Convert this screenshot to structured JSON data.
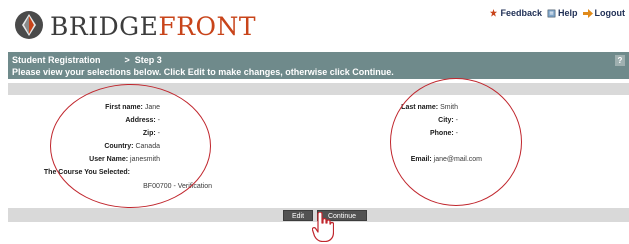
{
  "logo": {
    "name_part1": "BRIDGE",
    "name_part2": "FRONT"
  },
  "toplinks": [
    {
      "label": "Feedback",
      "icon": "feedback-icon"
    },
    {
      "label": "Help",
      "icon": "help-icon"
    },
    {
      "label": "Logout",
      "icon": "logout-arrow-icon"
    }
  ],
  "header": {
    "title": "Student Registration",
    "step_arrow": ">",
    "step": "Step 3",
    "instructions": "Please view your selections below. Click Edit to make changes, otherwise click Continue.",
    "help_icon": "?"
  },
  "left_fields": [
    {
      "label": "First name:",
      "value": "Jane"
    },
    {
      "label": "Address:",
      "value": "-"
    },
    {
      "label": "Zip:",
      "value": "-"
    },
    {
      "label": "Country:",
      "value": "Canada"
    },
    {
      "label": "User Name:",
      "value": "janesmith"
    },
    {
      "label": "The Course You Selected:",
      "value": ""
    }
  ],
  "course": {
    "value": "BF00700 - Verification"
  },
  "right_fields": [
    {
      "label": "Last name:",
      "value": "Smith"
    },
    {
      "label": "City:",
      "value": "-"
    },
    {
      "label": "Phone:",
      "value": "-"
    },
    {
      "label": "Email:",
      "value": "jane@mail.com"
    }
  ],
  "buttons": {
    "edit": "Edit",
    "continue": "Continue"
  },
  "colors": {
    "header_bar": "#6f8a8b",
    "accent_logo": "#c8441a",
    "annotation_circle": "#c0262d",
    "button": "#525252"
  }
}
